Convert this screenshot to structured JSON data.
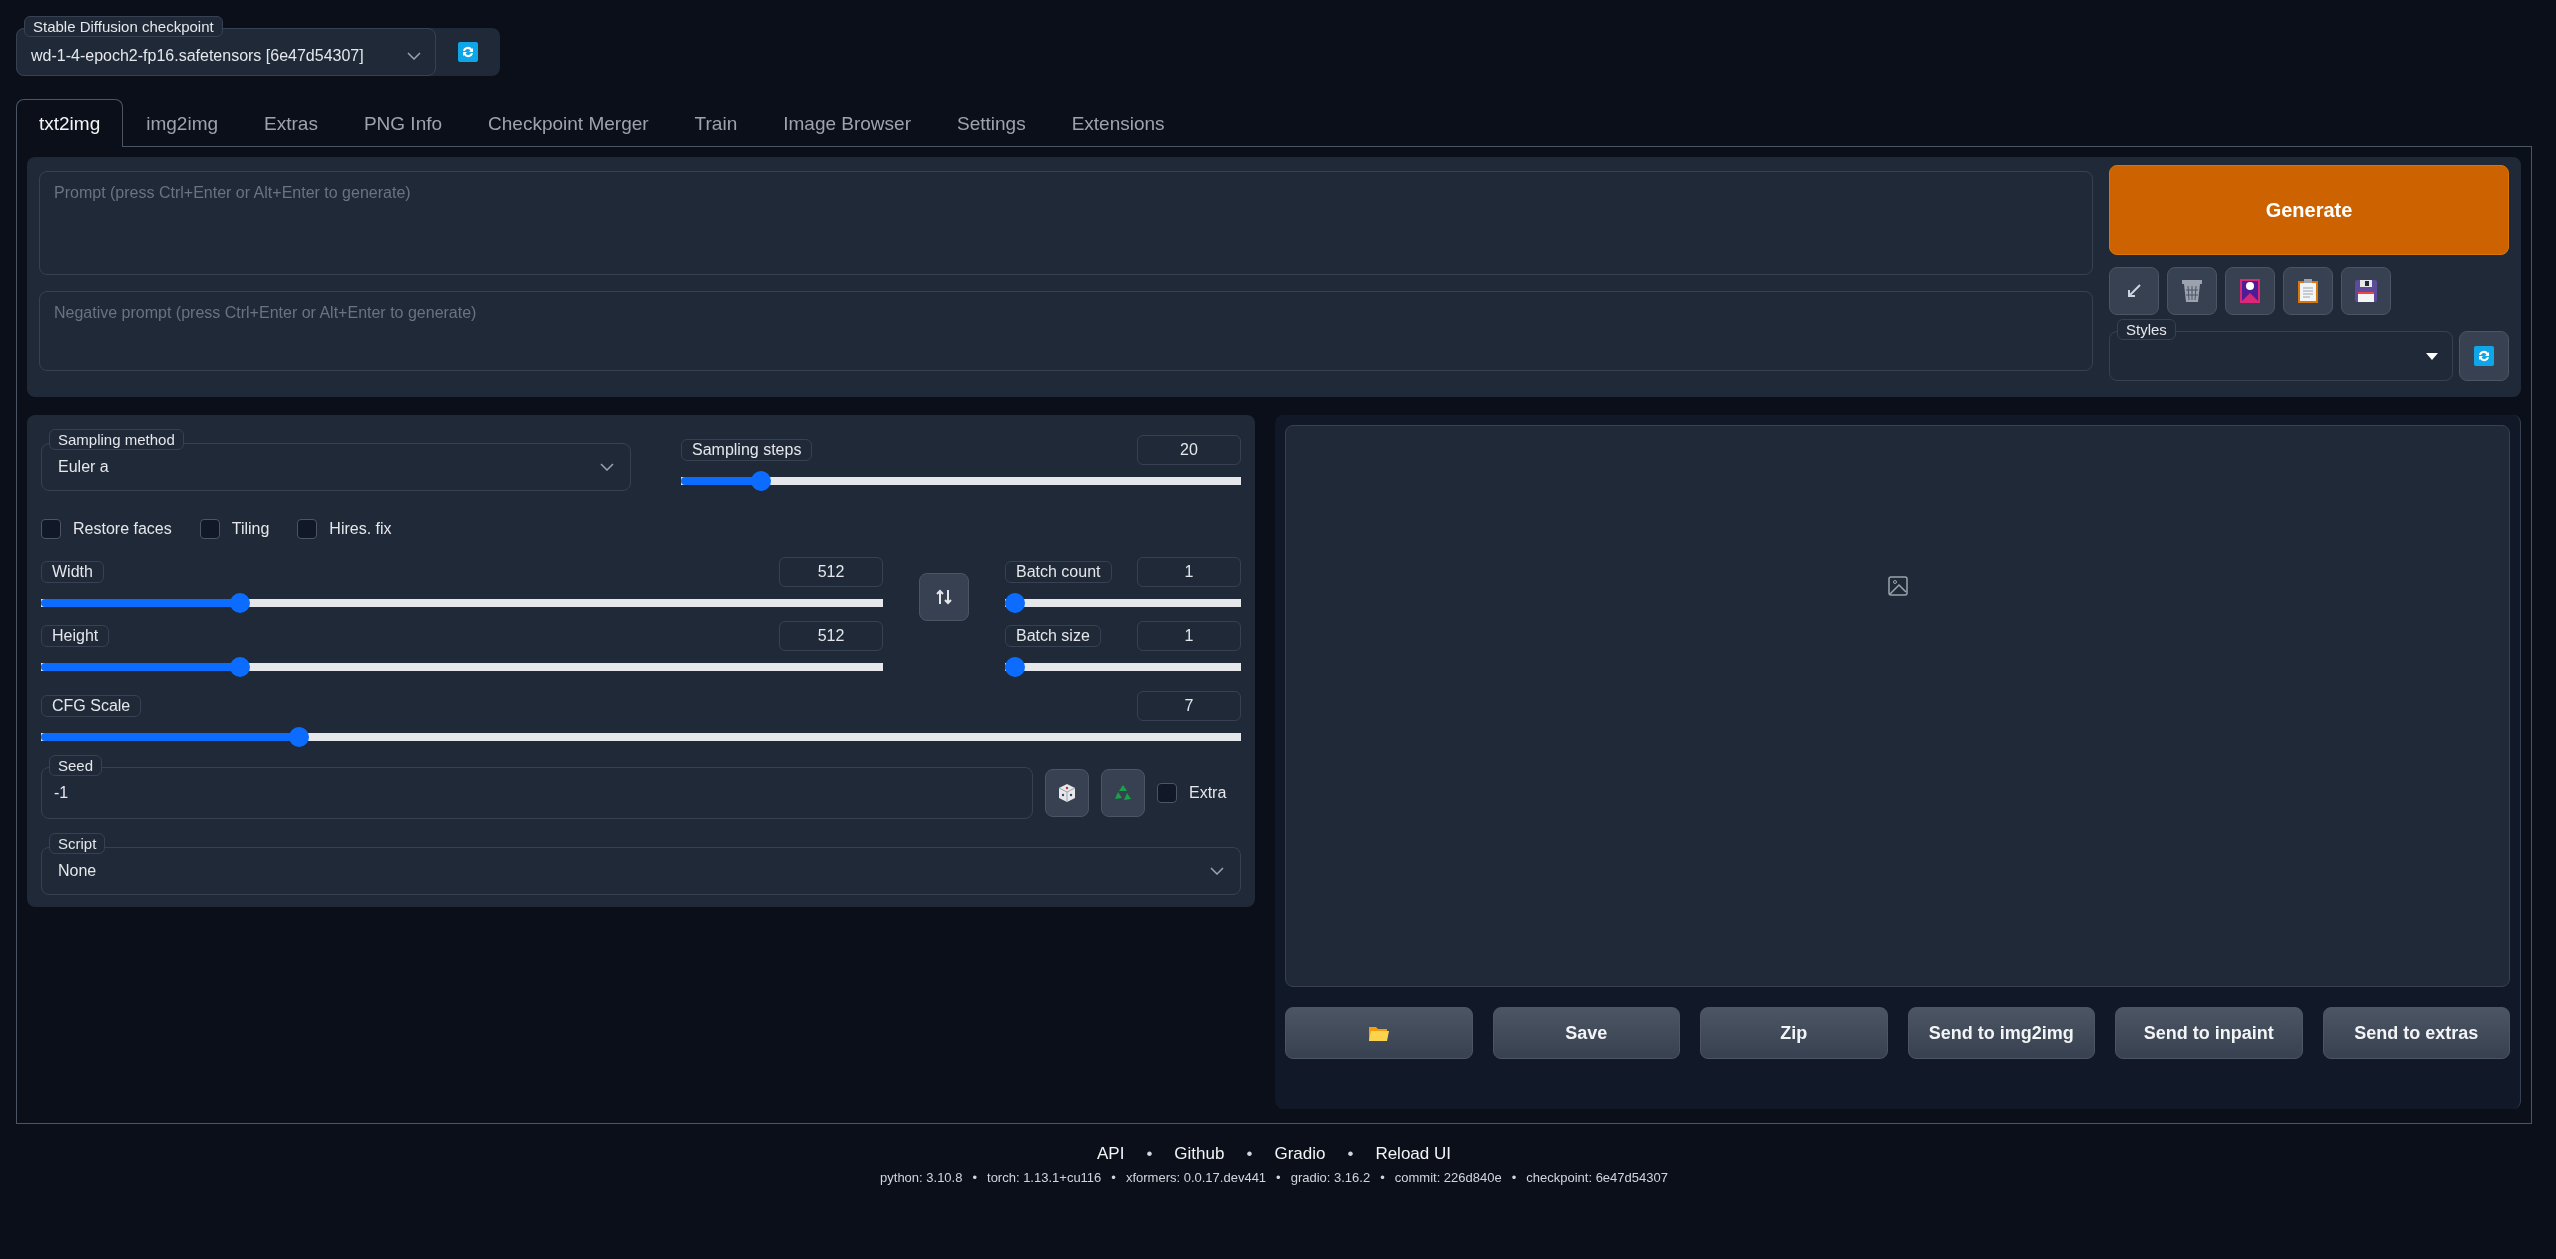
{
  "checkpoint": {
    "label": "Stable Diffusion checkpoint",
    "value": "wd-1-4-epoch2-fp16.safetensors [6e47d54307]"
  },
  "tabs": [
    {
      "label": "txt2img",
      "selected": true
    },
    {
      "label": "img2img",
      "selected": false
    },
    {
      "label": "Extras",
      "selected": false
    },
    {
      "label": "PNG Info",
      "selected": false
    },
    {
      "label": "Checkpoint Merger",
      "selected": false
    },
    {
      "label": "Train",
      "selected": false
    },
    {
      "label": "Image Browser",
      "selected": false
    },
    {
      "label": "Settings",
      "selected": false
    },
    {
      "label": "Extensions",
      "selected": false
    }
  ],
  "prompt": {
    "placeholder": "Prompt (press Ctrl+Enter or Alt+Enter to generate)"
  },
  "negative_prompt": {
    "placeholder": "Negative prompt (press Ctrl+Enter or Alt+Enter to generate)"
  },
  "generate": "Generate",
  "styles": {
    "label": "Styles"
  },
  "sampling_method": {
    "label": "Sampling method",
    "value": "Euler a"
  },
  "sampling_steps": {
    "label": "Sampling steps",
    "value": "20",
    "level": 0.13
  },
  "checkboxes": [
    {
      "label": "Restore faces",
      "checked": false
    },
    {
      "label": "Tiling",
      "checked": false
    },
    {
      "label": "Hires. fix",
      "checked": false
    }
  ],
  "size_sliders": [
    {
      "label": "Width",
      "value": "512",
      "level": 0.23
    },
    {
      "label": "Height",
      "value": "512",
      "level": 0.23
    }
  ],
  "batch_sliders": [
    {
      "label": "Batch count",
      "value": "1",
      "level": 0
    },
    {
      "label": "Batch size",
      "value": "1",
      "level": 0
    }
  ],
  "cfg_scale": {
    "label": "CFG Scale",
    "value": "7",
    "level": 0.21
  },
  "seed": {
    "label": "Seed",
    "value": "-1",
    "extra": {
      "label": "Extra",
      "checked": false
    }
  },
  "script": {
    "label": "Script",
    "value": "None"
  },
  "output_buttons": [
    "Save",
    "Zip",
    "Send to img2img",
    "Send to inpaint",
    "Send to extras"
  ],
  "footer": {
    "separator": "•",
    "links": [
      "API",
      "Github",
      "Gradio",
      "Reload UI"
    ],
    "versions": [
      "python: 3.10.8",
      "torch: 1.13.1+cu116",
      "xformers: 0.0.17.dev441",
      "gradio: 3.16.2",
      "commit: 226d840e",
      "checkpoint: 6e47d54307"
    ]
  }
}
